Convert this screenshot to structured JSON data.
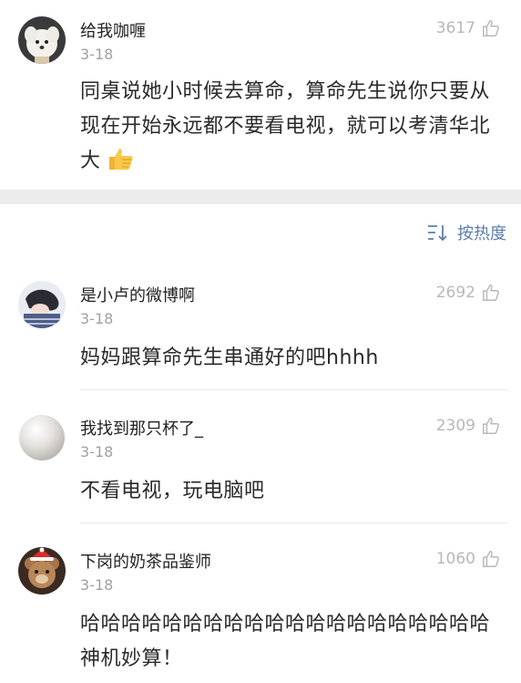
{
  "top_comment": {
    "username": "给我咖喱",
    "date": "3-18",
    "likes": "3617",
    "text": "同桌说她小时候去算命，算命先生说你只要从现在开始永远都不要看电视，就可以考清华北大",
    "emoji": "thumbs-up-emoji"
  },
  "sort": {
    "label": "按热度",
    "icon": "sort-icon",
    "color": "#5b7fad"
  },
  "comments": [
    {
      "username": "是小卢的微博啊",
      "date": "3-18",
      "likes": "2692",
      "text": "妈妈跟算命先生串通好的吧hhhh"
    },
    {
      "username": "我找到那只杯了_",
      "date": "3-18",
      "likes": "2309",
      "text": "不看电视，玩电脑吧"
    },
    {
      "username": "下岗的奶茶品鉴师",
      "date": "3-18",
      "likes": "1060",
      "text": "哈哈哈哈哈哈哈哈哈哈哈哈哈哈哈哈哈哈哈哈神机妙算！"
    }
  ],
  "colors": {
    "like_gray": "#b8b8b8",
    "date_gray": "#a0a0a0",
    "band_gray": "#ececec"
  }
}
